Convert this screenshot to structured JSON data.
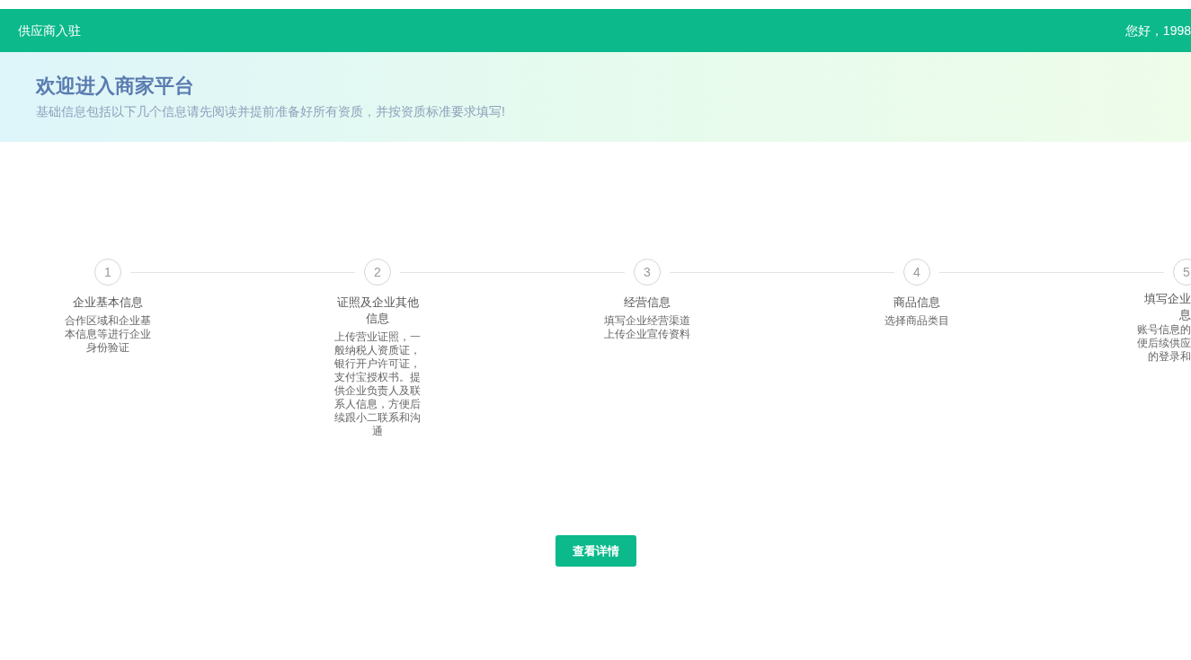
{
  "header": {
    "title": "供应商入驻",
    "greeting": "您好，1998"
  },
  "banner": {
    "title": "欢迎进入商家平台",
    "subtitle": "基础信息包括以下几个信息请先阅读并提前准备好所有资质，并按资质标准要求填写!"
  },
  "steps": [
    {
      "number": "1",
      "title": "企业基本信息",
      "description": "合作区域和企业基本信息等进行企业身份验证"
    },
    {
      "number": "2",
      "title": "证照及企业其他信息",
      "description": "上传营业证照，一般纳税人资质证，银行开户许可证，支付宝授权书。提供企业负责人及联系人信息，方便后续跟小二联系和沟通"
    },
    {
      "number": "3",
      "title": "经营信息",
      "description": "填写企业经营渠道上传企业宣传资料"
    },
    {
      "number": "4",
      "title": "商品信息",
      "description": "选择商品类目"
    },
    {
      "number": "5",
      "title": [
        "填写企业",
        "息"
      ],
      "description": [
        "账号信息的",
        "便后续供应",
        "的登录和"
      ]
    }
  ],
  "button": "查看详情"
}
